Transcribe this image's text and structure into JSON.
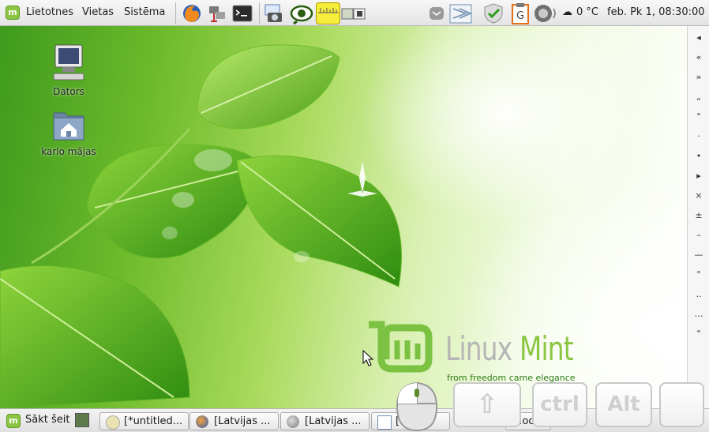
{
  "top_panel": {
    "menu": [
      "Lietotnes",
      "Vietas",
      "Sistēma"
    ],
    "weather": "0 °C",
    "clock": "feb. Pk  1, 08:30:00"
  },
  "desktop": {
    "icons": [
      {
        "label": "Dators",
        "icon": "computer-icon"
      },
      {
        "label": "karlo mājas",
        "icon": "home-folder-icon"
      }
    ],
    "wallpaper": {
      "brand": "Linux Mint",
      "brand_part1": "Linux ",
      "brand_part2": "Mint",
      "tagline": "from freedom came elegance",
      "colors": {
        "green": "#7cc242",
        "dark_green": "#2e7d16"
      }
    }
  },
  "right_strip": {
    "glyphs": [
      "◂",
      "«",
      "»",
      "„",
      "\"",
      "·",
      "•",
      "▸",
      "×",
      "±",
      "–",
      "—",
      "°",
      "‥",
      "…",
      "\""
    ]
  },
  "bottom_panel": {
    "start_label": "Sākt šeit",
    "tasks": [
      {
        "label": "[*untitled...",
        "icon": "text-editor-icon"
      },
      {
        "label": "[Latvijas ...",
        "icon": "firefox-icon"
      },
      {
        "label": "[Latvijas ...",
        "icon": "web-browser-icon"
      },
      {
        "label": "[...",
        "icon": "document-icon"
      },
      {
        "label": "...oc",
        "icon": "document-icon"
      }
    ]
  },
  "onscreen_keys": {
    "shift": "⇧",
    "ctrl": "ctrl",
    "alt": "Alt",
    "blank": ""
  }
}
